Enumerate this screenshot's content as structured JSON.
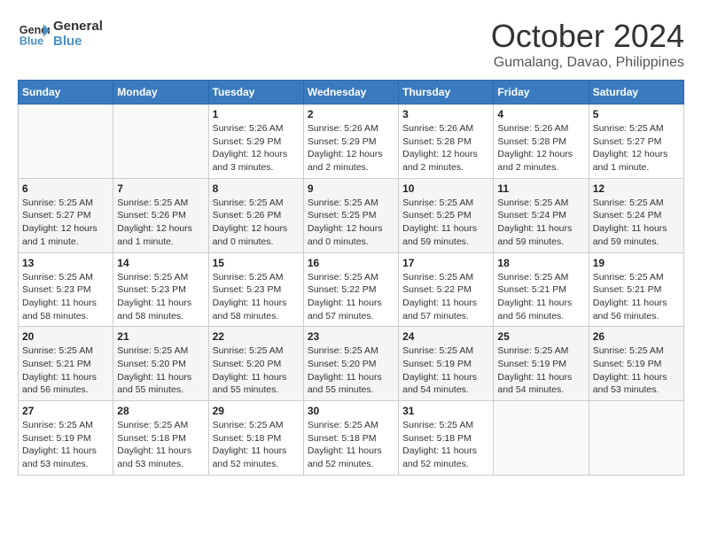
{
  "header": {
    "logo_line1": "General",
    "logo_line2": "Blue",
    "title": "October 2024",
    "subtitle": "Gumalang, Davao, Philippines"
  },
  "calendar": {
    "weekdays": [
      "Sunday",
      "Monday",
      "Tuesday",
      "Wednesday",
      "Thursday",
      "Friday",
      "Saturday"
    ],
    "weeks": [
      [
        {
          "day": "",
          "info": ""
        },
        {
          "day": "",
          "info": ""
        },
        {
          "day": "1",
          "info": "Sunrise: 5:26 AM\nSunset: 5:29 PM\nDaylight: 12 hours and 3 minutes."
        },
        {
          "day": "2",
          "info": "Sunrise: 5:26 AM\nSunset: 5:29 PM\nDaylight: 12 hours and 2 minutes."
        },
        {
          "day": "3",
          "info": "Sunrise: 5:26 AM\nSunset: 5:28 PM\nDaylight: 12 hours and 2 minutes."
        },
        {
          "day": "4",
          "info": "Sunrise: 5:26 AM\nSunset: 5:28 PM\nDaylight: 12 hours and 2 minutes."
        },
        {
          "day": "5",
          "info": "Sunrise: 5:25 AM\nSunset: 5:27 PM\nDaylight: 12 hours and 1 minute."
        }
      ],
      [
        {
          "day": "6",
          "info": "Sunrise: 5:25 AM\nSunset: 5:27 PM\nDaylight: 12 hours and 1 minute."
        },
        {
          "day": "7",
          "info": "Sunrise: 5:25 AM\nSunset: 5:26 PM\nDaylight: 12 hours and 1 minute."
        },
        {
          "day": "8",
          "info": "Sunrise: 5:25 AM\nSunset: 5:26 PM\nDaylight: 12 hours and 0 minutes."
        },
        {
          "day": "9",
          "info": "Sunrise: 5:25 AM\nSunset: 5:25 PM\nDaylight: 12 hours and 0 minutes."
        },
        {
          "day": "10",
          "info": "Sunrise: 5:25 AM\nSunset: 5:25 PM\nDaylight: 11 hours and 59 minutes."
        },
        {
          "day": "11",
          "info": "Sunrise: 5:25 AM\nSunset: 5:24 PM\nDaylight: 11 hours and 59 minutes."
        },
        {
          "day": "12",
          "info": "Sunrise: 5:25 AM\nSunset: 5:24 PM\nDaylight: 11 hours and 59 minutes."
        }
      ],
      [
        {
          "day": "13",
          "info": "Sunrise: 5:25 AM\nSunset: 5:23 PM\nDaylight: 11 hours and 58 minutes."
        },
        {
          "day": "14",
          "info": "Sunrise: 5:25 AM\nSunset: 5:23 PM\nDaylight: 11 hours and 58 minutes."
        },
        {
          "day": "15",
          "info": "Sunrise: 5:25 AM\nSunset: 5:23 PM\nDaylight: 11 hours and 58 minutes."
        },
        {
          "day": "16",
          "info": "Sunrise: 5:25 AM\nSunset: 5:22 PM\nDaylight: 11 hours and 57 minutes."
        },
        {
          "day": "17",
          "info": "Sunrise: 5:25 AM\nSunset: 5:22 PM\nDaylight: 11 hours and 57 minutes."
        },
        {
          "day": "18",
          "info": "Sunrise: 5:25 AM\nSunset: 5:21 PM\nDaylight: 11 hours and 56 minutes."
        },
        {
          "day": "19",
          "info": "Sunrise: 5:25 AM\nSunset: 5:21 PM\nDaylight: 11 hours and 56 minutes."
        }
      ],
      [
        {
          "day": "20",
          "info": "Sunrise: 5:25 AM\nSunset: 5:21 PM\nDaylight: 11 hours and 56 minutes."
        },
        {
          "day": "21",
          "info": "Sunrise: 5:25 AM\nSunset: 5:20 PM\nDaylight: 11 hours and 55 minutes."
        },
        {
          "day": "22",
          "info": "Sunrise: 5:25 AM\nSunset: 5:20 PM\nDaylight: 11 hours and 55 minutes."
        },
        {
          "day": "23",
          "info": "Sunrise: 5:25 AM\nSunset: 5:20 PM\nDaylight: 11 hours and 55 minutes."
        },
        {
          "day": "24",
          "info": "Sunrise: 5:25 AM\nSunset: 5:19 PM\nDaylight: 11 hours and 54 minutes."
        },
        {
          "day": "25",
          "info": "Sunrise: 5:25 AM\nSunset: 5:19 PM\nDaylight: 11 hours and 54 minutes."
        },
        {
          "day": "26",
          "info": "Sunrise: 5:25 AM\nSunset: 5:19 PM\nDaylight: 11 hours and 53 minutes."
        }
      ],
      [
        {
          "day": "27",
          "info": "Sunrise: 5:25 AM\nSunset: 5:19 PM\nDaylight: 11 hours and 53 minutes."
        },
        {
          "day": "28",
          "info": "Sunrise: 5:25 AM\nSunset: 5:18 PM\nDaylight: 11 hours and 53 minutes."
        },
        {
          "day": "29",
          "info": "Sunrise: 5:25 AM\nSunset: 5:18 PM\nDaylight: 11 hours and 52 minutes."
        },
        {
          "day": "30",
          "info": "Sunrise: 5:25 AM\nSunset: 5:18 PM\nDaylight: 11 hours and 52 minutes."
        },
        {
          "day": "31",
          "info": "Sunrise: 5:25 AM\nSunset: 5:18 PM\nDaylight: 11 hours and 52 minutes."
        },
        {
          "day": "",
          "info": ""
        },
        {
          "day": "",
          "info": ""
        }
      ]
    ]
  }
}
